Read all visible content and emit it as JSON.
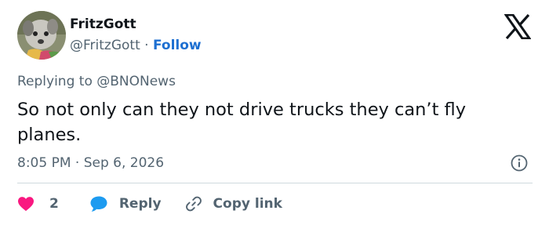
{
  "user": {
    "display_name": "FritzGott",
    "handle": "@FritzGott",
    "separator": "·",
    "follow_label": "Follow"
  },
  "tweet": {
    "reply_prefix": "Replying to",
    "reply_mention": "@BNONews",
    "text": "So not only can they not drive trucks they can’t fly planes.",
    "time": "8:05 PM",
    "meta_separator": "·",
    "date": "Sep 6, 2026"
  },
  "actions": {
    "like_count": "2",
    "reply_label": "Reply",
    "copy_link_label": "Copy link"
  },
  "icons": {
    "brand": "x-logo-icon",
    "info": "info-icon",
    "like": "heart-icon",
    "reply": "speech-bubble-icon",
    "copy": "link-icon"
  },
  "colors": {
    "follow": "#1d6fd1",
    "heart": "#f91880",
    "reply_bubble": "#1d9bf0",
    "muted_text": "#536471"
  }
}
